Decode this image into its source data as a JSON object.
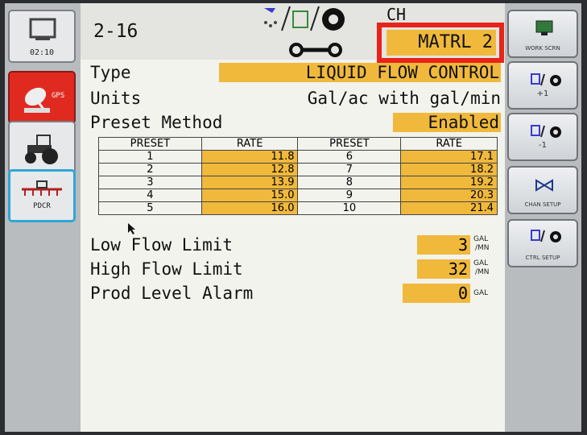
{
  "header": {
    "code": "2-16",
    "ch_label": "CH",
    "material": "MATRL 2"
  },
  "left_panel": {
    "clock": "02:10",
    "gps_label": "GPS",
    "pdcr_label": "PDCR"
  },
  "settings": {
    "type_label": "Type",
    "type_value": "LIQUID FLOW CONTROL",
    "units_label": "Units",
    "units_value": "Gal/ac with gal/min",
    "preset_method_label": "Preset Method",
    "preset_method_value": "Enabled"
  },
  "preset_table": {
    "headers": [
      "PRESET",
      "RATE",
      "PRESET",
      "RATE"
    ],
    "rows": [
      {
        "p1": "1",
        "r1": "11.8",
        "p2": "6",
        "r2": "17.1"
      },
      {
        "p1": "2",
        "r1": "12.8",
        "p2": "7",
        "r2": "18.2"
      },
      {
        "p1": "3",
        "r1": "13.9",
        "p2": "8",
        "r2": "19.2"
      },
      {
        "p1": "4",
        "r1": "15.0",
        "p2": "9",
        "r2": "20.3"
      },
      {
        "p1": "5",
        "r1": "16.0",
        "p2": "10",
        "r2": "21.4"
      }
    ]
  },
  "limits": {
    "low_label": "Low Flow Limit",
    "low_value": "3",
    "low_unit_top": "GAL",
    "low_unit_bottom": "/MN",
    "high_label": "High Flow Limit",
    "high_value": "32",
    "high_unit_top": "GAL",
    "high_unit_bottom": "/MN",
    "alarm_label": "Prod Level Alarm",
    "alarm_value": "0",
    "alarm_unit": "GAL"
  },
  "right_panel": {
    "work_screen": "WORK SCRN",
    "plus_one": "+1",
    "minus_one": "-1",
    "chan_setup": "CHAN SETUP",
    "ctrl_setup": "CTRL SETUP"
  }
}
